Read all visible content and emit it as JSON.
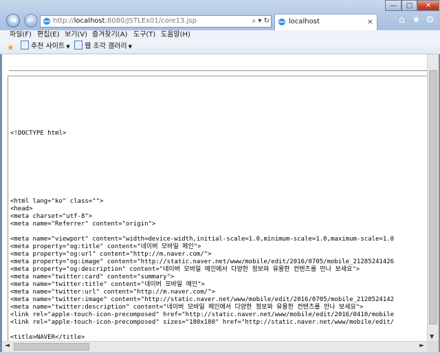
{
  "browser": {
    "address": {
      "prefix": "http://",
      "host": "localhost",
      "path": ":8080/JSTLEx01/core13.jsp"
    },
    "tab": {
      "title": "localhost",
      "close": "×"
    },
    "window_controls": {
      "minimize": "—",
      "maximize": "□",
      "close": "✕"
    }
  },
  "menu": [
    "파일(F)",
    "편집(E)",
    "보기(V)",
    "즐겨찾기(A)",
    "도구(T)",
    "도움말(H)"
  ],
  "favorites": [
    "추천 사이트",
    "웹 조각 갤러리"
  ],
  "source_lines": [
    "<!DOCTYPE html>",
    "",
    "",
    "",
    "",
    "",
    "",
    "",
    "",
    "<html lang=\"ko\" class=\"\">",
    "<head>",
    "<meta charset=\"utf-8\">",
    "<meta name=\"Referrer\" content=\"origin\">",
    "",
    "<meta name=\"viewport\" content=\"width=device-width,initial-scale=1.0,minimum-scale=1.0,maximum-scale=1.0",
    "<meta property=\"og:title\" content=\"네이버 모바일 메인\">",
    "<meta property=\"og:url\" content=\"http://m.naver.com/\">",
    "<meta property=\"og:image\" content=\"http://static.naver.net/www/mobile/edit/2016/0705/mobile_21285241426",
    "<meta property=\"og:description\" content=\"네이버 모바일 메인에서 다양한 정보와 유용한 컨텐츠를 만나 보세요\">",
    "<meta name=\"twitter:card\" content=\"summary\">",
    "<meta name=\"twitter:title\" content=\"네이버 모바일 메인\">",
    "<meta name=\"twitter:url\" content=\"http://m.naver.com/\">",
    "<meta name=\"twitter:image\" content=\"http://static.naver.net/www/mobile/edit/2016/0705/mobile_2128524142",
    "<meta name=\"twitter:description\" content=\"네이버 모바일 메인에서 다양한 정보와 유용한 컨텐츠를 만나 보세요\">",
    "<link rel=\"apple-touch-icon-precomposed\" href=\"http://static.naver.net/www/mobile/edit/2016/0410/mobile",
    "<link rel=\"apple-touch-icon-precomposed\" sizes=\"180x180\" href=\"http://static.naver.net/www/mobile/edit/",
    "",
    "<title>NAVER</title>"
  ],
  "icons": {
    "back": "back-arrow-icon",
    "forward": "forward-arrow-icon",
    "search": "search-icon",
    "refresh": "refresh-icon",
    "home": "home-icon",
    "favorites": "star-icon",
    "tools": "gear-icon"
  }
}
